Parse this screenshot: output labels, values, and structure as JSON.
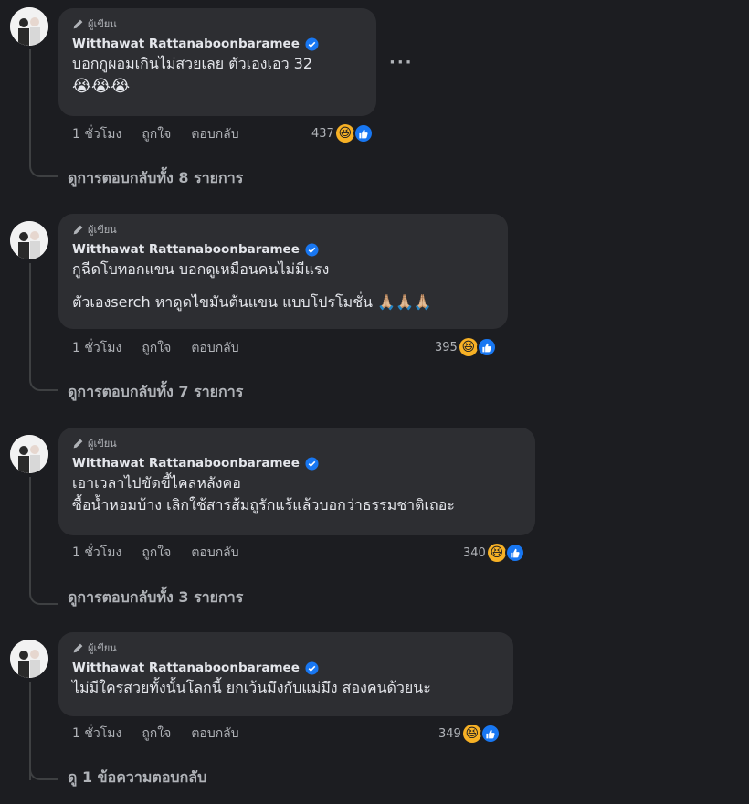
{
  "comments": [
    {
      "badge": "ผู้เขียน",
      "author": "Witthawat Rattanaboonbaramee",
      "lines": [
        "บอกกูผอมเกินไม่สวยเลย ตัวเองเอว 32",
        "😭😭😭"
      ],
      "time": "1 ชั่วโมง",
      "like": "ถูกใจ",
      "reply": "ตอบกลับ",
      "reactions": "437",
      "view_replies": "ดูการตอบกลับทั้ง 8 รายการ",
      "more": "···"
    },
    {
      "badge": "ผู้เขียน",
      "author": "Witthawat Rattanaboonbaramee",
      "lines": [
        "กูฉีดโบทอกแขน บอกดูเหมือนคนไม่มีแรง",
        "ตัวเองserch หาดูดไขมันต้นแขน แบบโปรโมชั่น 🙏🏼🙏🏼🙏🏼"
      ],
      "time": "1 ชั่วโมง",
      "like": "ถูกใจ",
      "reply": "ตอบกลับ",
      "reactions": "395",
      "view_replies": "ดูการตอบกลับทั้ง 7 รายการ"
    },
    {
      "badge": "ผู้เขียน",
      "author": "Witthawat Rattanaboonbaramee",
      "lines": [
        "เอาเวลาไปขัดขี้ไคลหลังคอ",
        "ซื้อน้ำหอมบ้าง เลิกใช้สารส้มถูรักแร้แล้วบอกว่าธรรมชาติเถอะ"
      ],
      "time": "1 ชั่วโมง",
      "like": "ถูกใจ",
      "reply": "ตอบกลับ",
      "reactions": "340",
      "view_replies": "ดูการตอบกลับทั้ง 3 รายการ"
    },
    {
      "badge": "ผู้เขียน",
      "author": "Witthawat Rattanaboonbaramee",
      "lines": [
        "ไม่มีใครสวยทั้งนั้นโลกนี้ ยกเว้นมึงกับแม่มึง สองคนด้วยนะ"
      ],
      "time": "1 ชั่วโมง",
      "like": "ถูกใจ",
      "reply": "ตอบกลับ",
      "reactions": "349",
      "view_replies": "ดู 1 ข้อความตอบกลับ"
    }
  ],
  "colors": {
    "background": "#1c1d21",
    "bubble": "#2d2e32",
    "verified": "#1877f2",
    "muted": "#b0b3b8"
  }
}
